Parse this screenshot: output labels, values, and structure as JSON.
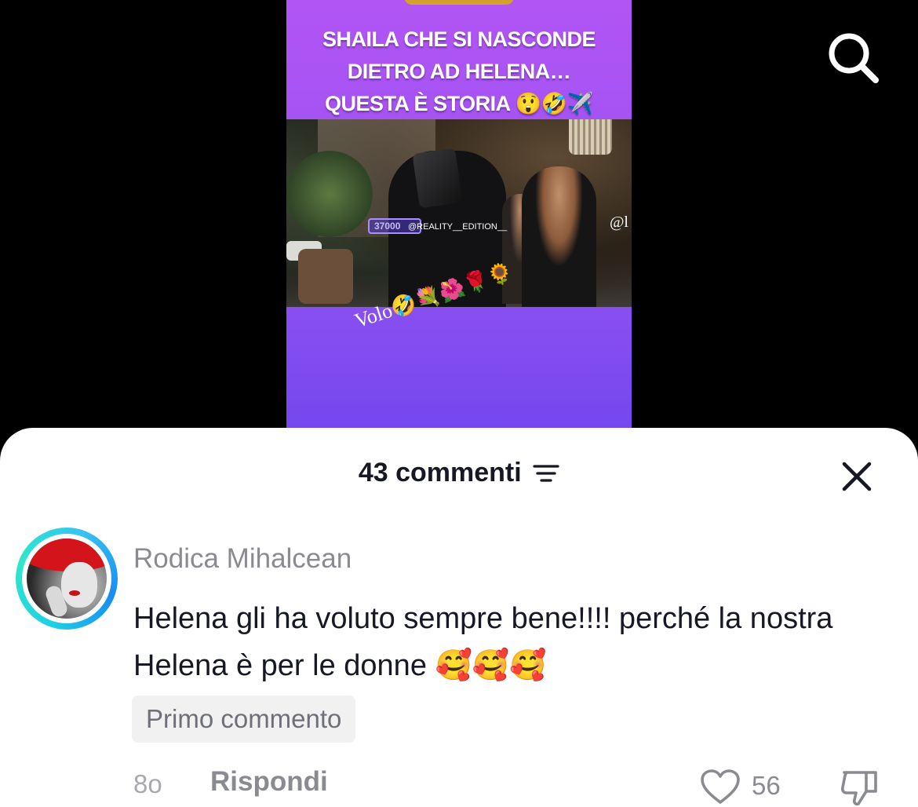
{
  "video": {
    "caption_lines": [
      "SHAILA CHE SI NASCONDE",
      "DIETRO AD HELENA…",
      "QUESTA È STORIA 😲🤣✈️"
    ],
    "counter_label": "37000",
    "watermark": "@REALITY__EDITION__",
    "watermark_partial": "@l",
    "overlay_text": "Volo",
    "overlay_emojis": "🤣💐🌺🌹🌻"
  },
  "top_bar": {
    "search_icon": "search-icon"
  },
  "comments_sheet": {
    "title": "43 commenti",
    "sort_icon": "sort-lines-icon",
    "close_icon": "close-icon",
    "comment": {
      "username": "Rodica Mihalcean",
      "text": "Helena gli ha voluto sempre bene!!!! perché la nostra Helena è per le donne 🥰🥰🥰",
      "badge": "Primo commento",
      "time": "8o",
      "reply_label": "Rispondi",
      "like_count": "56",
      "like_icon": "heart-outline-icon",
      "dislike_icon": "thumbs-down-icon"
    }
  },
  "colors": {
    "video_gradient_top": "#b255f5",
    "video_gradient_bottom": "#7447ef",
    "avatar_ring": "#1fd1e6",
    "text_primary": "#161823",
    "text_secondary": "#8a8b91"
  }
}
